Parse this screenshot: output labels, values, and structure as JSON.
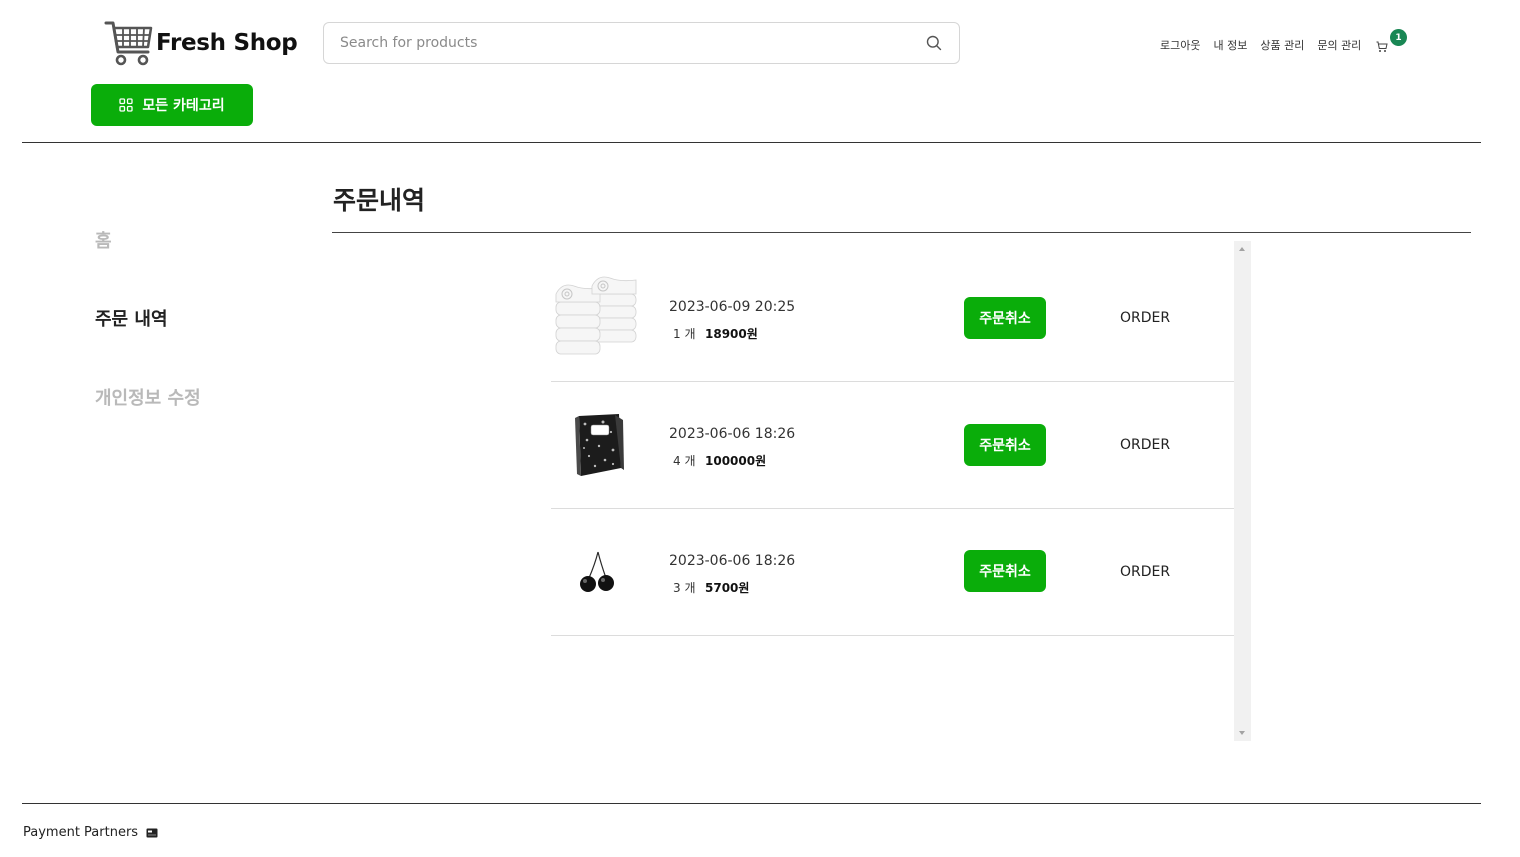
{
  "header": {
    "logo_text": "Fresh Shop",
    "search_placeholder": "Search for products",
    "nav": {
      "logout": "로그아웃",
      "my_info": "내 정보",
      "product_manage": "상품 관리",
      "inquiry_manage": "문의 관리"
    },
    "cart_count": "1",
    "category_button": "모든 카테고리"
  },
  "sidebar": {
    "items": [
      {
        "label": "홈",
        "active": false
      },
      {
        "label": "주문 내역",
        "active": true
      },
      {
        "label": "개인정보 수정",
        "active": false
      }
    ]
  },
  "main": {
    "title": "주문내역",
    "orders": [
      {
        "product_icon": "towel-icon",
        "date": "2023-06-09 20:25",
        "qty": "1 개",
        "price": "18900원",
        "cancel_label": "주문취소",
        "status": "ORDER"
      },
      {
        "product_icon": "notebook-icon",
        "date": "2023-06-06 18:26",
        "qty": "4 개",
        "price": "100000원",
        "cancel_label": "주문취소",
        "status": "ORDER"
      },
      {
        "product_icon": "cherry-icon",
        "date": "2023-06-06 18:26",
        "qty": "3 개",
        "price": "5700원",
        "cancel_label": "주문취소",
        "status": "ORDER"
      }
    ]
  },
  "footer": {
    "label": "Payment Partners"
  },
  "colors": {
    "accent": "#0aad0a",
    "badge": "#198754"
  }
}
